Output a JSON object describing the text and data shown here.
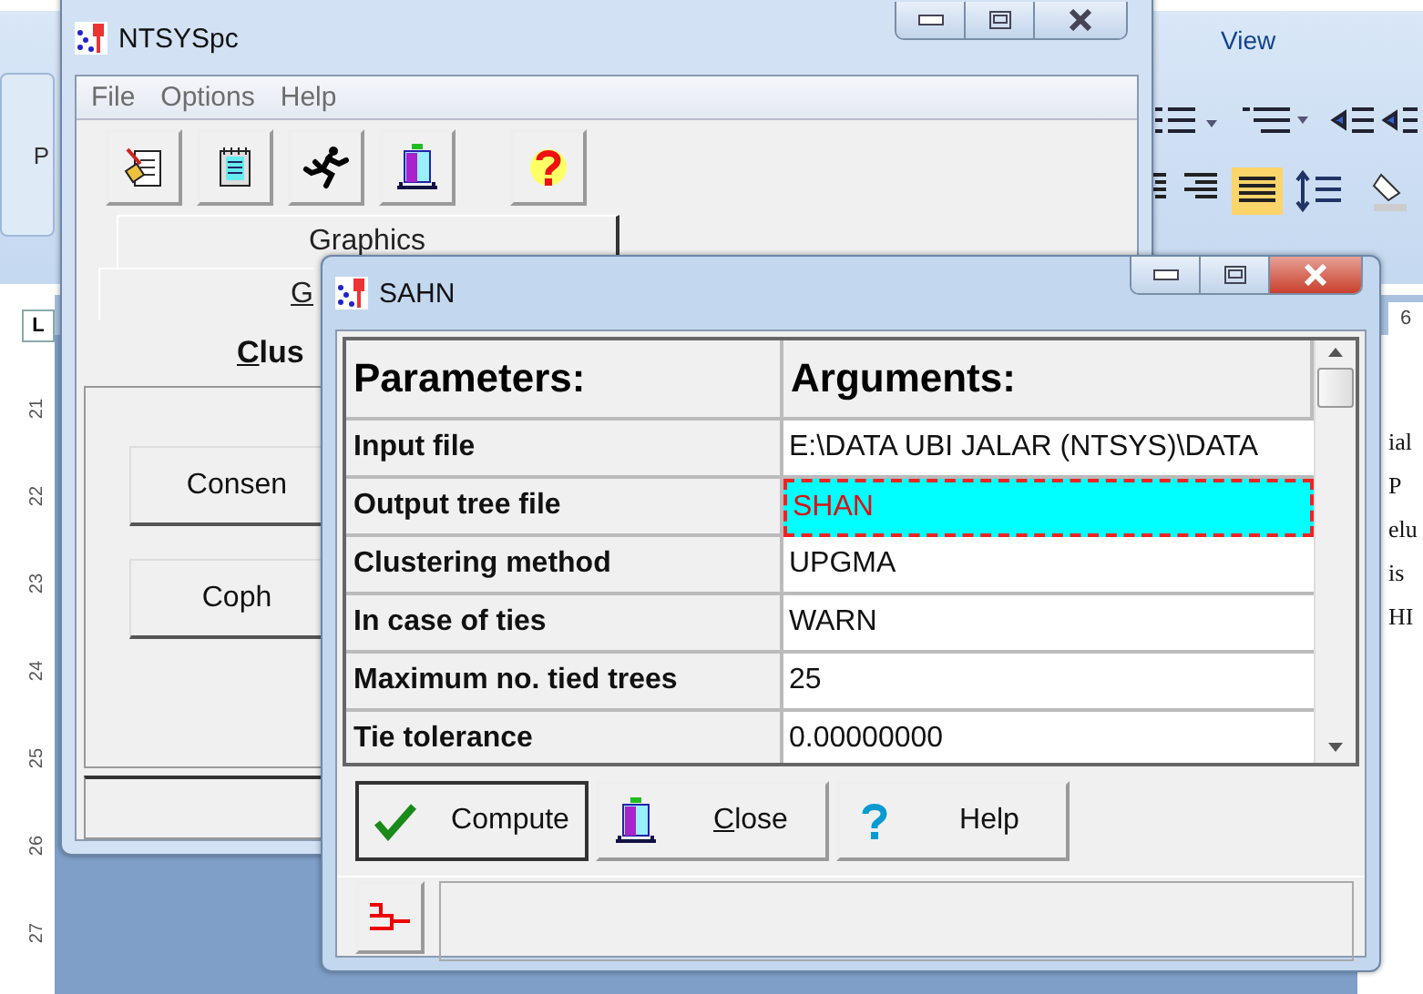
{
  "background_app": {
    "ribbon_tab": "View",
    "paste_label": "P",
    "ruler_corner": "L",
    "top_ruler_number": "6",
    "ruler_numbers": [
      "21",
      "22",
      "23",
      "24",
      "25",
      "26",
      "27"
    ],
    "document_fragments": [
      "ial",
      "P",
      "elu",
      "is",
      "HI"
    ]
  },
  "main_window": {
    "title": "NTSYSpc",
    "menu": [
      "File",
      "Options",
      "Help"
    ],
    "toolbar": [
      {
        "kind": "notes"
      },
      {
        "kind": "notepad"
      },
      {
        "kind": "runner"
      },
      {
        "kind": "exit"
      },
      {
        "kind": "help"
      }
    ],
    "tabs_row_1": [
      {
        "label": "Graphics",
        "selected": false
      }
    ],
    "tabs_row_2": [
      {
        "label": "G",
        "selected": false,
        "mnemonic": true
      }
    ],
    "section_title": {
      "text": "Clus",
      "mnemonic": true
    },
    "buttons": [
      "Consen",
      "Coph"
    ]
  },
  "dialog": {
    "title": "SAHN",
    "columns": [
      "Parameters:",
      "Arguments:"
    ],
    "rows": [
      {
        "parameter": "Input file",
        "argument": "E:\\DATA UBI JALAR (NTSYS)\\DATA",
        "selected": false
      },
      {
        "parameter": "Output tree file",
        "argument": "SHAN",
        "selected": true
      },
      {
        "parameter": "Clustering method",
        "argument": "UPGMA",
        "selected": false
      },
      {
        "parameter": "In case of ties",
        "argument": "WARN",
        "selected": false
      },
      {
        "parameter": "Maximum no. tied trees",
        "argument": "25",
        "selected": false
      },
      {
        "parameter": "Tie tolerance",
        "argument": "0.00000000",
        "selected": false
      }
    ],
    "buttons": [
      {
        "kind": "compute",
        "label": "Compute",
        "mnemonic": false
      },
      {
        "kind": "close",
        "label": "Close",
        "mnemonic": true
      },
      {
        "kind": "help",
        "label": "Help",
        "mnemonic": false
      }
    ]
  }
}
